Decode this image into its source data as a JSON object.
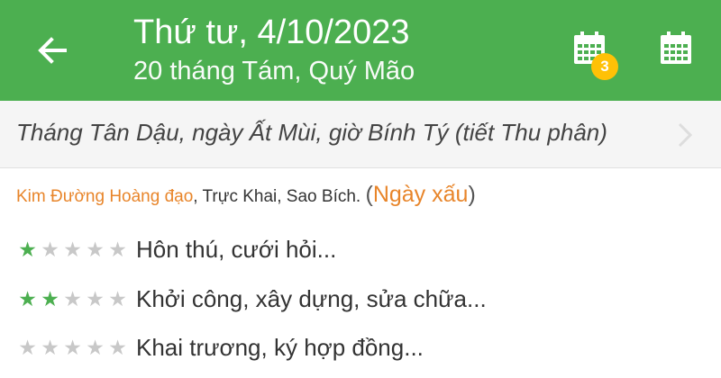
{
  "header": {
    "title": "Thứ tư, 4/10/2023",
    "subtitle": "20 tháng Tám, Quý Mão",
    "back_icon": "arrow-left-icon",
    "calendar_icon": "calendar-icon",
    "badge_count": "3"
  },
  "lunar": {
    "text": "Tháng Tân Dậu, ngày Ất Mùi, giờ Bính Tý (tiết Thu phân)",
    "chevron_icon": "chevron-right-icon"
  },
  "day_info": {
    "hoang_dao": "Kim Đường Hoàng đạo",
    "details": ", Trực Khai, Sao Bích.",
    "open_paren": "(",
    "quality": "Ngày xấu",
    "close_paren": ")"
  },
  "ratings": [
    {
      "stars": 1,
      "max": 5,
      "label": "Hôn thú, cưới hỏi..."
    },
    {
      "stars": 2,
      "max": 5,
      "label": "Khởi công, xây dựng, sửa chữa..."
    },
    {
      "stars": 0,
      "max": 5,
      "label": "Khai trương, ký hợp đồng..."
    }
  ],
  "colors": {
    "primary": "#4caf50",
    "accent": "#e8852a",
    "badge": "#ffc107"
  }
}
